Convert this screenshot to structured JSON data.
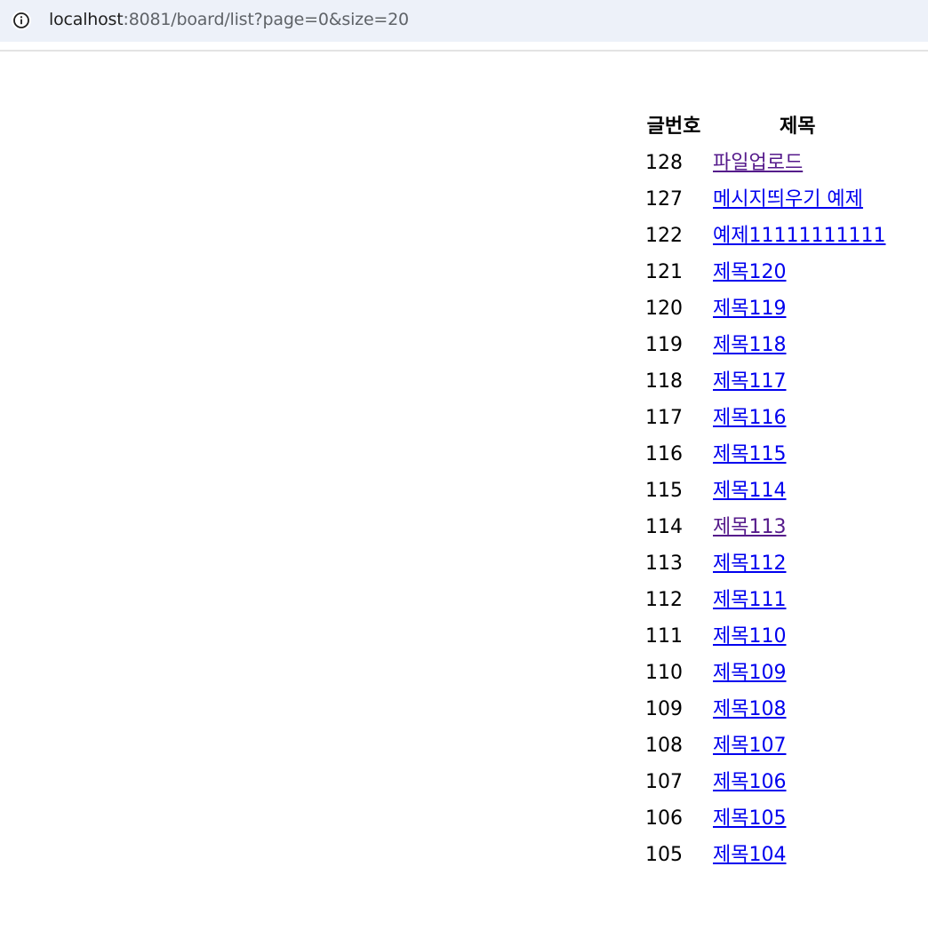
{
  "browser": {
    "url_host": "localhost",
    "url_rest": ":8081/board/list?page=0&size=20",
    "icon": "info-icon"
  },
  "board": {
    "headers": {
      "number": "글번호",
      "title": "제목"
    },
    "rows": [
      {
        "number": "128",
        "title": "파일업로드",
        "visited": true
      },
      {
        "number": "127",
        "title": "메시지띄우기 예제",
        "visited": false
      },
      {
        "number": "122",
        "title": "예제11111111111",
        "visited": false
      },
      {
        "number": "121",
        "title": "제목120",
        "visited": false
      },
      {
        "number": "120",
        "title": "제목119",
        "visited": false
      },
      {
        "number": "119",
        "title": "제목118",
        "visited": false
      },
      {
        "number": "118",
        "title": "제목117",
        "visited": false
      },
      {
        "number": "117",
        "title": "제목116",
        "visited": false
      },
      {
        "number": "116",
        "title": "제목115",
        "visited": false
      },
      {
        "number": "115",
        "title": "제목114",
        "visited": false
      },
      {
        "number": "114",
        "title": "제목113",
        "visited": true
      },
      {
        "number": "113",
        "title": "제목112",
        "visited": false
      },
      {
        "number": "112",
        "title": "제목111",
        "visited": false
      },
      {
        "number": "111",
        "title": "제목110",
        "visited": false
      },
      {
        "number": "110",
        "title": "제목109",
        "visited": false
      },
      {
        "number": "109",
        "title": "제목108",
        "visited": false
      },
      {
        "number": "108",
        "title": "제목107",
        "visited": false
      },
      {
        "number": "107",
        "title": "제목106",
        "visited": false
      },
      {
        "number": "106",
        "title": "제목105",
        "visited": false
      },
      {
        "number": "105",
        "title": "제목104",
        "visited": false
      }
    ]
  },
  "colors": {
    "link": "#0000ee",
    "visited_link": "#551a8b",
    "url_bar_bg": "#edf1f9"
  }
}
